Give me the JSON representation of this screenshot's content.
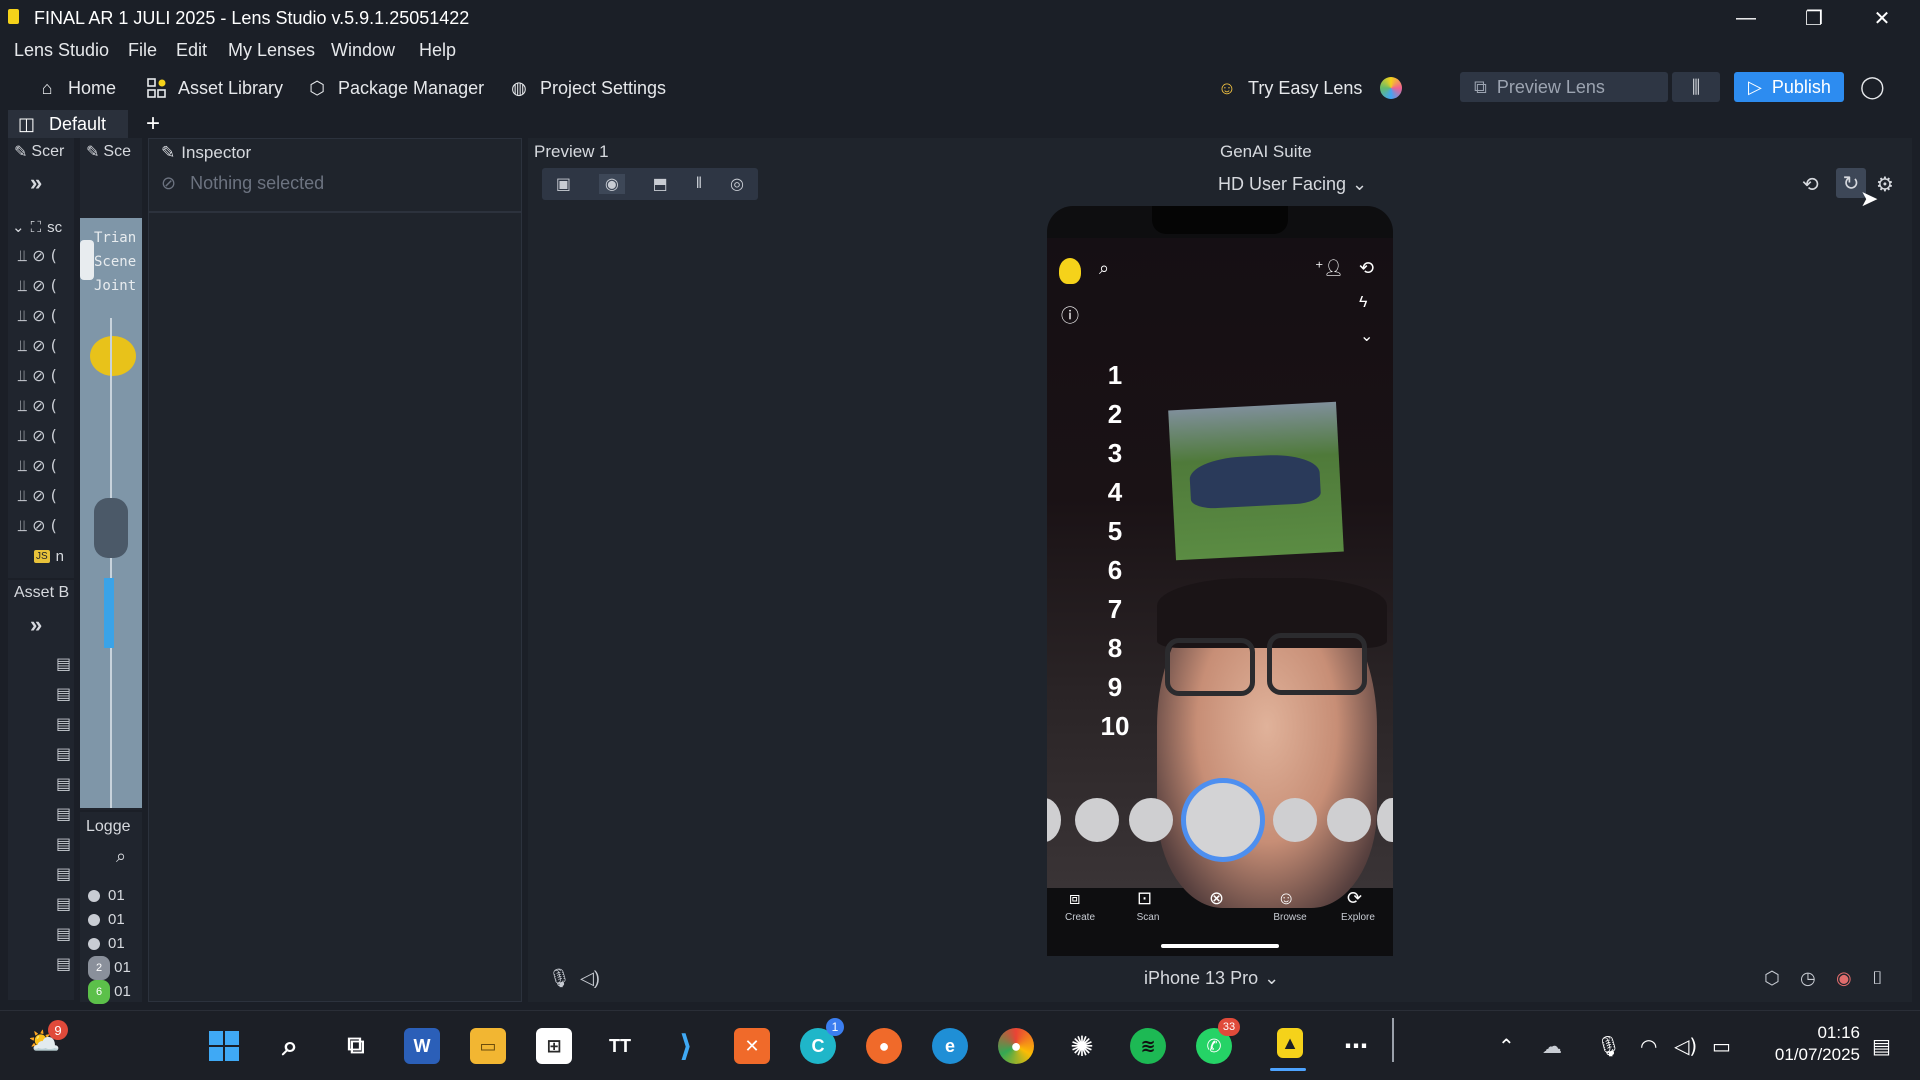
{
  "window": {
    "title": "FINAL AR 1 JULI 2025 - Lens Studio v.5.9.1.25051422",
    "minimize": "—",
    "maximize": "❐",
    "close": "✕"
  },
  "menu": [
    "Lens Studio",
    "File",
    "Edit",
    "My Lenses",
    "Window",
    "Help"
  ],
  "toolbar": {
    "home": "Home",
    "asset_library": "Asset Library",
    "package_manager": "Package Manager",
    "project_settings": "Project Settings",
    "try_easy_lens": "Try Easy Lens",
    "preview_lens": "Preview Lens",
    "publish": "Publish"
  },
  "layout": {
    "tab": "Default",
    "add": "+"
  },
  "panels": {
    "scene_hierarchy": "Scer",
    "scene_view": "Sce",
    "scene_root": "sc",
    "asset_browser": "Asset B",
    "logger": "Logge",
    "inspector": "Inspector",
    "inspector_empty": "Nothing selected",
    "preview": "Preview 1",
    "genai": "GenAI Suite",
    "camera_mode": "HD User Facing",
    "device": "iPhone 13 Pro",
    "script_label": "n",
    "scene_view_lines": [
      "Trian",
      "Scene",
      "Joint"
    ]
  },
  "logger_rows": [
    {
      "badge": "",
      "text": "01"
    },
    {
      "badge": "",
      "text": "01"
    },
    {
      "badge": "",
      "text": "01"
    },
    {
      "badge": "2",
      "text": "01"
    },
    {
      "badge": "6",
      "text": "01"
    }
  ],
  "phone": {
    "numbers": [
      "1",
      "2",
      "3",
      "4",
      "5",
      "6",
      "7",
      "8",
      "9",
      "10"
    ],
    "nav": [
      "Create",
      "Scan",
      "Browse",
      "Explore"
    ]
  },
  "taskbar": {
    "weather_badge": "9",
    "canva_badge": "1",
    "whatsapp_badge": "33",
    "time": "01:16",
    "date": "01/07/2025"
  },
  "colors": {
    "accent": "#2d8cf0",
    "snap_yellow": "#f5d21a"
  }
}
